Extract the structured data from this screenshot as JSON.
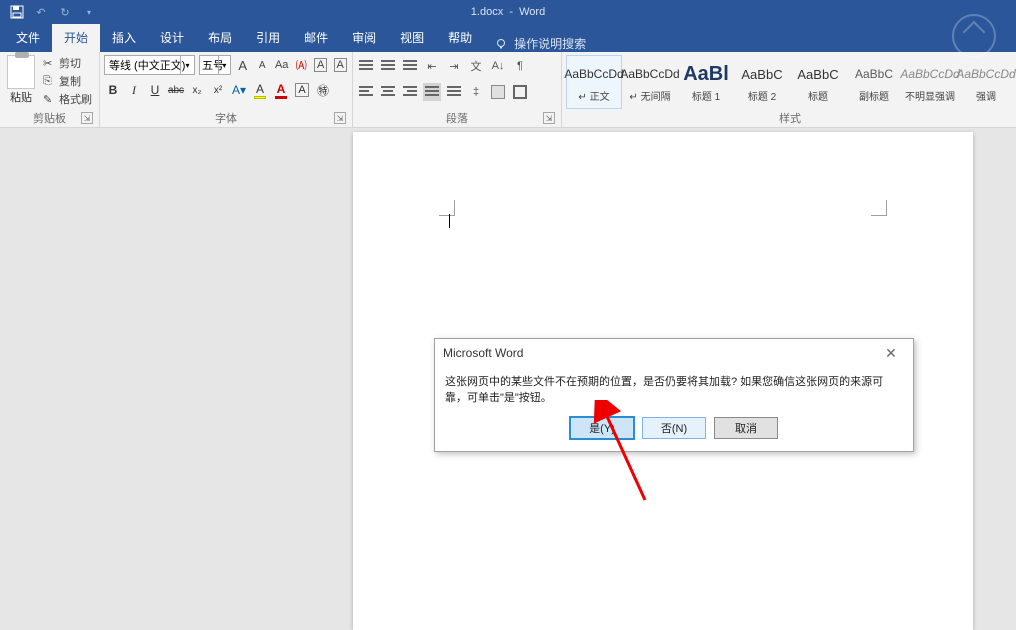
{
  "title": "1.docx  -  Word",
  "qat": {
    "save": "💾",
    "undo": "↶",
    "redo": "↻"
  },
  "tabs": {
    "file": "文件",
    "home": "开始",
    "insert": "插入",
    "design": "设计",
    "layout": "布局",
    "references": "引用",
    "mailings": "邮件",
    "review": "审阅",
    "view": "视图",
    "help": "帮助",
    "tell_me": "操作说明搜索"
  },
  "clipboard": {
    "paste": "粘贴",
    "cut": "剪切",
    "copy": "复制",
    "format_painter": "格式刷",
    "group_label": "剪贴板"
  },
  "font": {
    "name": "等线 (中文正文)",
    "size": "五号",
    "grow": "A",
    "shrink": "A",
    "case": "Aa",
    "clear": "A",
    "bold": "B",
    "italic": "I",
    "underline": "U",
    "strike": "abc",
    "sub": "x₂",
    "sup": "x²",
    "highlight": "A",
    "fontcolor": "A",
    "charshade": "A",
    "charborder": "A",
    "group_label": "字体"
  },
  "para": {
    "group_label": "段落"
  },
  "styles": {
    "group_label": "样式",
    "items": [
      {
        "preview": "AaBbCcDd",
        "label": "↵ 正文",
        "cls": ""
      },
      {
        "preview": "AaBbCcDd",
        "label": "↵ 无间隔",
        "cls": ""
      },
      {
        "preview": "AaBl",
        "label": "标题 1",
        "cls": "big"
      },
      {
        "preview": "AaBbC",
        "label": "标题 2",
        "cls": "h1"
      },
      {
        "preview": "AaBbC",
        "label": "标题",
        "cls": "h1"
      },
      {
        "preview": "AaBbC",
        "label": "副标题",
        "cls": "sub"
      },
      {
        "preview": "AaBbCcDd",
        "label": "不明显强调",
        "cls": "em"
      },
      {
        "preview": "AaBbCcDd",
        "label": "强调",
        "cls": "em"
      }
    ]
  },
  "dialog": {
    "title": "Microsoft Word",
    "message": "这张网页中的某些文件不在预期的位置，是否仍要将其加载? 如果您确信这张网页的来源可靠，可单击\"是\"按钮。",
    "yes": "是(Y)",
    "no": "否(N)",
    "cancel": "取消"
  }
}
